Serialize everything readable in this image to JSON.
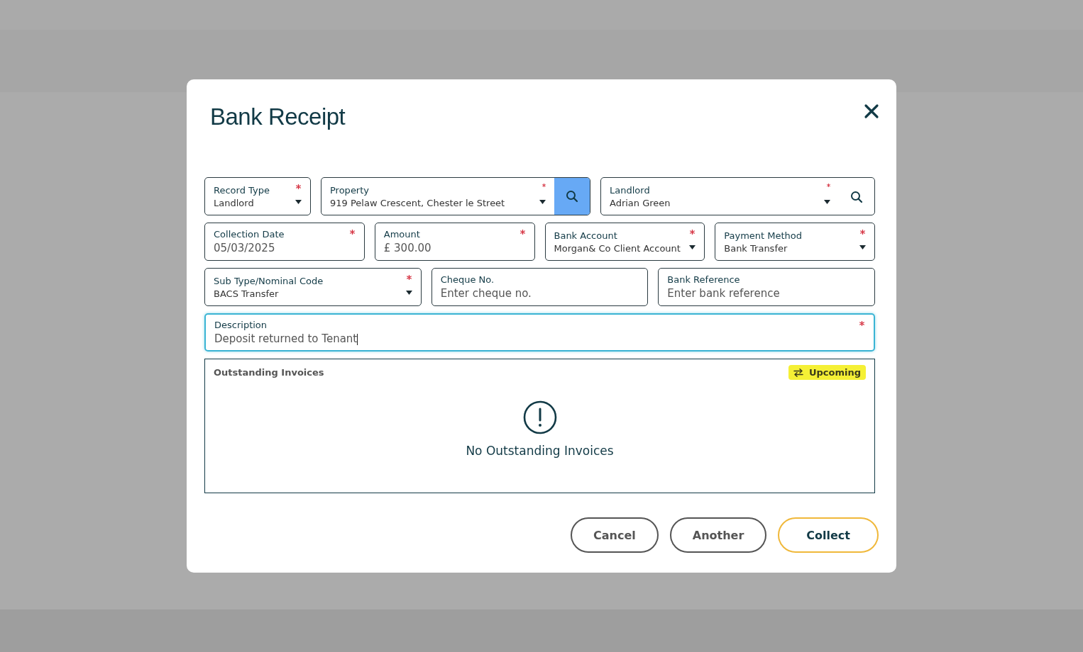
{
  "dialog": {
    "title": "Bank Receipt"
  },
  "field_rows": [
    [
      {
        "kind": "select",
        "label": "Record Type",
        "value": "Landlord",
        "required": true
      },
      {
        "kind": "select-search-button",
        "label": "Property",
        "value": "919 Pelaw Crescent, Chester le Street",
        "required": true
      },
      {
        "kind": "select-search",
        "label": "Landlord",
        "value": "Adrian Green",
        "required": true
      }
    ],
    [
      {
        "kind": "text",
        "label": "Collection Date",
        "value": "05/03/2025",
        "required": true
      },
      {
        "kind": "text",
        "label": "Amount",
        "value": "£ 300.00",
        "required": true
      },
      {
        "kind": "select",
        "label": "Bank Account",
        "value": "Morgan& Co Client Account",
        "required": true
      },
      {
        "kind": "select",
        "label": "Payment Method",
        "value": "Bank Transfer",
        "required": true
      }
    ],
    [
      {
        "kind": "select",
        "label": "Sub Type/Nominal Code",
        "value": "BACS Transfer",
        "required": true
      },
      {
        "kind": "text",
        "label": "Cheque No.",
        "placeholder": "Enter cheque no.",
        "required": false
      },
      {
        "kind": "text",
        "label": "Bank Reference",
        "placeholder": "Enter bank reference",
        "required": false
      }
    ],
    [
      {
        "kind": "text",
        "label": "Description",
        "value": "Deposit returned to Tenant",
        "required": true,
        "focused": true
      }
    ]
  ],
  "invoices": {
    "title": "Outstanding Invoices",
    "badge": "Upcoming",
    "empty_message": "No Outstanding Invoices"
  },
  "buttons": [
    {
      "label": "Cancel",
      "kind": "secondary"
    },
    {
      "label": "Another",
      "kind": "secondary"
    },
    {
      "label": "Collect",
      "kind": "primary"
    }
  ]
}
